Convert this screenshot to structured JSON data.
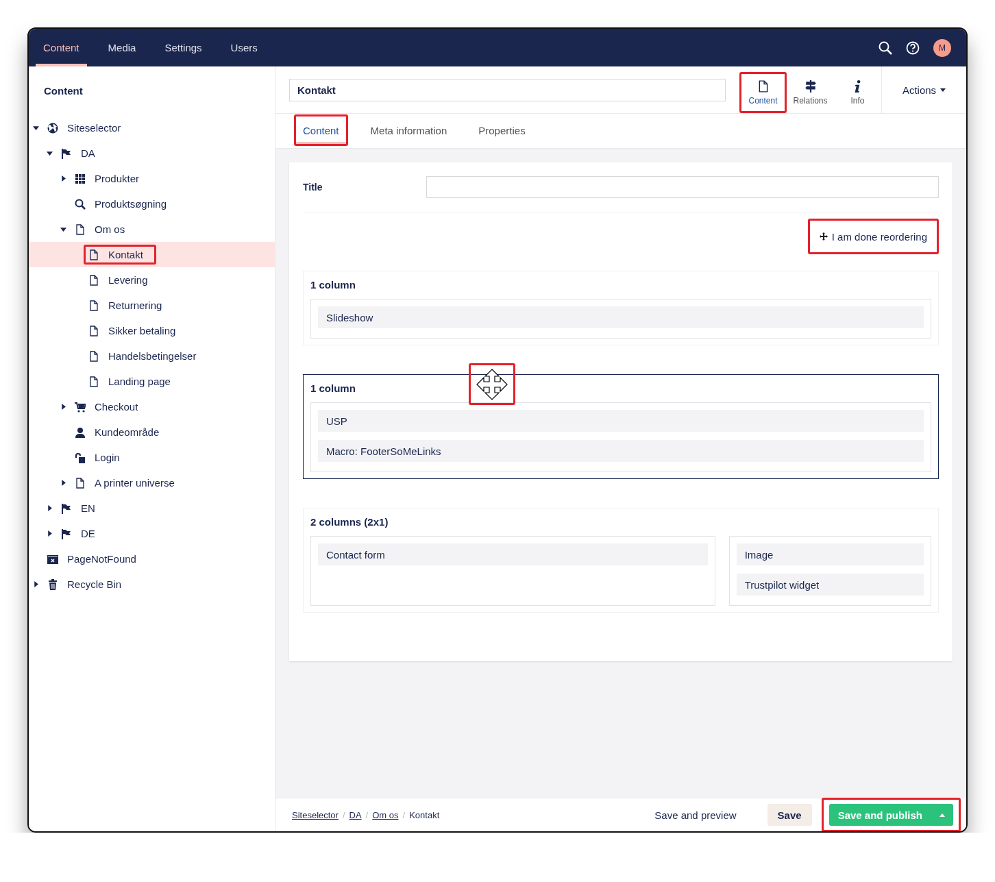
{
  "top_nav": {
    "sections": [
      {
        "label": "Content",
        "selected": true
      },
      {
        "label": "Media",
        "selected": false
      },
      {
        "label": "Settings",
        "selected": false
      },
      {
        "label": "Users",
        "selected": false
      }
    ],
    "avatar": "M"
  },
  "sidebar": {
    "title": "Content",
    "tree": [
      {
        "label": "Siteselector",
        "kind": "globe",
        "expanded": true,
        "selected": false,
        "highlighted": false,
        "children": [
          {
            "label": "DA",
            "kind": "flag",
            "expanded": true,
            "selected": false,
            "highlighted": false,
            "children": [
              {
                "label": "Produkter",
                "kind": "grid",
                "expanded": false,
                "selected": false,
                "highlighted": false
              },
              {
                "label": "Produktsøgning",
                "kind": "search",
                "selected": false,
                "highlighted": false
              },
              {
                "label": "Om os",
                "kind": "document",
                "expanded": true,
                "selected": false,
                "highlighted": false,
                "children": [
                  {
                    "label": "Kontakt",
                    "kind": "document",
                    "selected": true,
                    "highlighted": true
                  },
                  {
                    "label": "Levering",
                    "kind": "document",
                    "selected": false,
                    "highlighted": false
                  },
                  {
                    "label": "Returnering",
                    "kind": "document",
                    "selected": false,
                    "highlighted": false
                  },
                  {
                    "label": "Sikker betaling",
                    "kind": "document",
                    "selected": false,
                    "highlighted": false
                  },
                  {
                    "label": "Handelsbetingelser",
                    "kind": "document",
                    "selected": false,
                    "highlighted": false
                  },
                  {
                    "label": "Landing page",
                    "kind": "document",
                    "selected": false,
                    "highlighted": false
                  }
                ]
              },
              {
                "label": "Checkout",
                "kind": "cart",
                "expanded": false,
                "selected": false,
                "highlighted": false
              },
              {
                "label": "Kundeområde",
                "kind": "user",
                "selected": false,
                "highlighted": false
              },
              {
                "label": "Login",
                "kind": "unlock",
                "selected": false,
                "highlighted": false
              },
              {
                "label": "A printer universe",
                "kind": "document",
                "expanded": false,
                "selected": false,
                "highlighted": false
              }
            ]
          },
          {
            "label": "EN",
            "kind": "flag",
            "expanded": false,
            "selected": false,
            "highlighted": false
          },
          {
            "label": "DE",
            "kind": "flag",
            "expanded": false,
            "selected": false,
            "highlighted": false
          }
        ]
      },
      {
        "label": "PageNotFound",
        "kind": "calendar-x",
        "selected": false,
        "highlighted": false
      },
      {
        "label": "Recycle Bin",
        "kind": "trash",
        "expanded": false,
        "selected": false,
        "highlighted": false
      }
    ]
  },
  "editor": {
    "name_field": {
      "value": "Kontakt"
    },
    "apps": [
      {
        "label": "Content",
        "kind": "document",
        "selected": true,
        "highlighted": true
      },
      {
        "label": "Relations",
        "kind": "signpost",
        "selected": false,
        "highlighted": false
      },
      {
        "label": "Info",
        "kind": "info",
        "selected": false,
        "highlighted": false
      }
    ],
    "actions": {
      "label": "Actions"
    },
    "tabs": [
      {
        "label": "Content",
        "selected": true,
        "highlighted": true
      },
      {
        "label": "Meta information",
        "selected": false,
        "highlighted": false
      },
      {
        "label": "Properties",
        "selected": false,
        "highlighted": false
      }
    ],
    "title_property": {
      "label": "Title"
    },
    "reorder_button": {
      "label": "I am done reordering",
      "highlighted": true
    },
    "sections": [
      {
        "title": "1 column",
        "active": false,
        "columns": [
          [
            "Slideshow"
          ]
        ]
      },
      {
        "title": "1 column",
        "active": true,
        "columns": [
          [
            "USP",
            "Macro: FooterSoMeLinks"
          ]
        ]
      },
      {
        "title": "2 columns (2x1)",
        "active": false,
        "columns": [
          [
            "Contact form"
          ],
          [
            "Image",
            "Trustpilot widget"
          ]
        ]
      }
    ],
    "drag_cursor": {
      "highlighted": true
    }
  },
  "footer": {
    "separator": "/",
    "breadcrumb": [
      {
        "label": "Siteselector",
        "link": true
      },
      {
        "label": "DA",
        "link": true
      },
      {
        "label": "Om os",
        "link": true
      },
      {
        "label": "Kontakt",
        "link": false
      }
    ],
    "buttons": [
      {
        "label": "Save and preview",
        "kind": "plain",
        "highlighted": false
      },
      {
        "label": "Save",
        "kind": "secondary",
        "highlighted": false
      },
      {
        "label": "Save and publish",
        "kind": "primary",
        "highlighted": true
      }
    ]
  }
}
